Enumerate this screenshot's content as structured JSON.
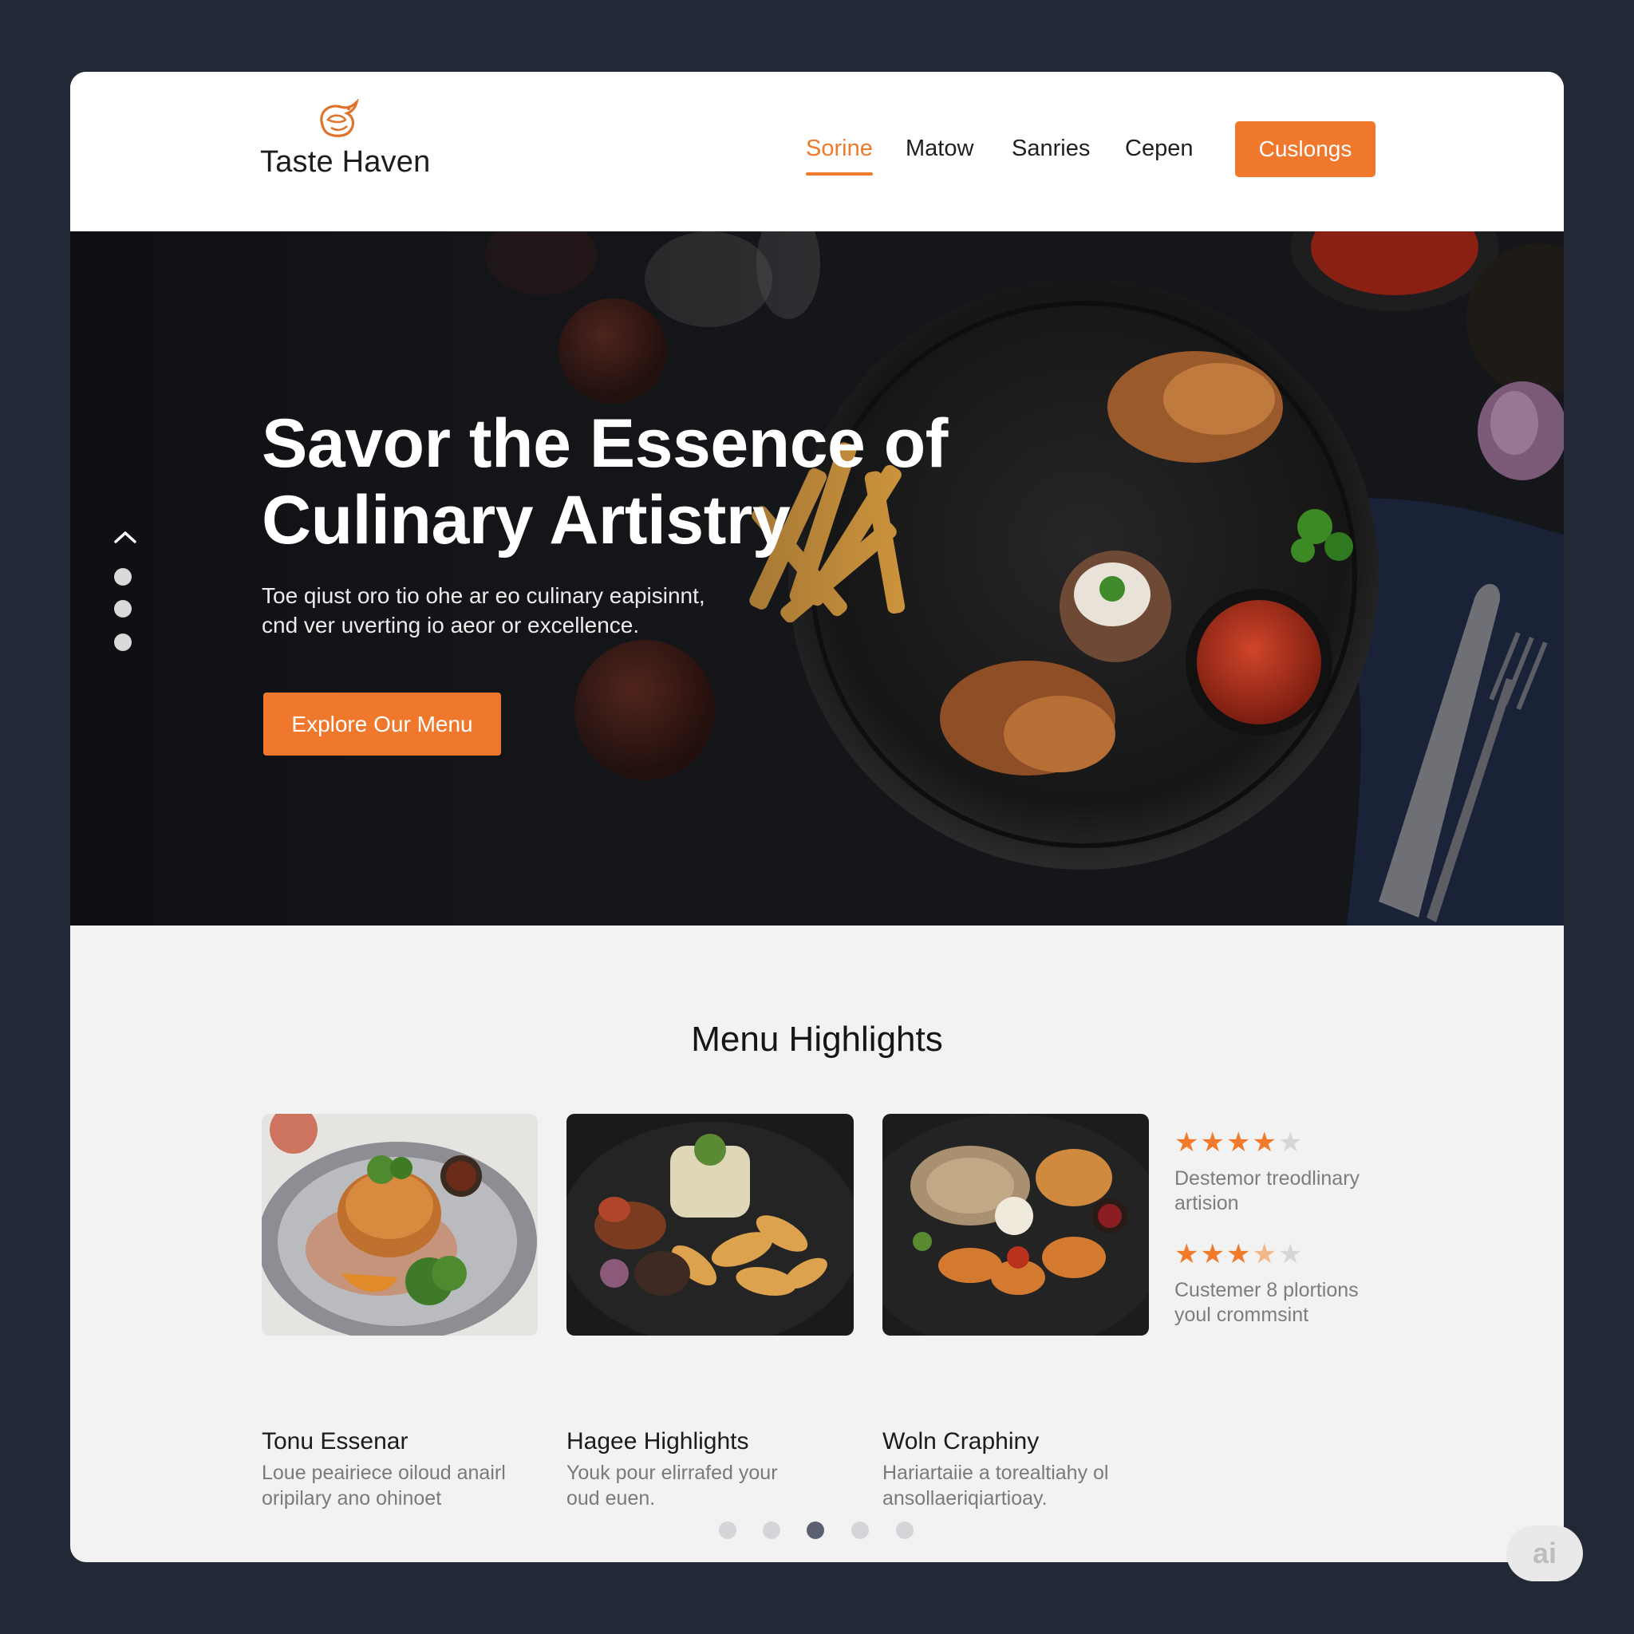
{
  "brand": {
    "name": "Taste Haven",
    "logo_icon": "dragon-logo-icon",
    "accent": "#f0782c"
  },
  "nav": {
    "items": [
      {
        "label": "Sorine",
        "active": true
      },
      {
        "label": "Matow",
        "active": false
      },
      {
        "label": "Sanries",
        "active": false
      },
      {
        "label": "Cepen",
        "active": false
      }
    ],
    "cta_label": "Cuslongs"
  },
  "hero": {
    "title_line1": "Savor the Essence of",
    "title_line2": "Culinary Artistry",
    "subtitle_line1": "Toe qiust oro tio ohe ar eo culinary eapisinnt,",
    "subtitle_line2": "cnd ver uverting io aeor or excellence.",
    "button_label": "Explore Our Menu",
    "slider_up_icon": "chevron-up-icon",
    "slider_dots": 3
  },
  "highlights": {
    "title": "Menu Highlights",
    "cards": [
      {
        "name": "Tonu Essenar",
        "desc_line1": "Loue peairiece oiloud anairl",
        "desc_line2": "oripilary ano ohinoet"
      },
      {
        "name": "Hagee Highlights",
        "desc_line1": "Youk pour elirrafed your",
        "desc_line2": "oud euen."
      },
      {
        "name": "Woln Craphiny",
        "desc_line1": "Hariartaiie a torealtiahy ol",
        "desc_line2": "ansollaeriqiartioay."
      }
    ],
    "reviews": [
      {
        "rating": 4,
        "text_line1": "Destemor treodlinary",
        "text_line2": "artision"
      },
      {
        "rating": 3.5,
        "text_line1": "Custemer 8 plortions",
        "text_line2": "youl crommsint"
      }
    ],
    "pagination": {
      "total": 5,
      "active_index": 2
    }
  },
  "watermark": "ai"
}
